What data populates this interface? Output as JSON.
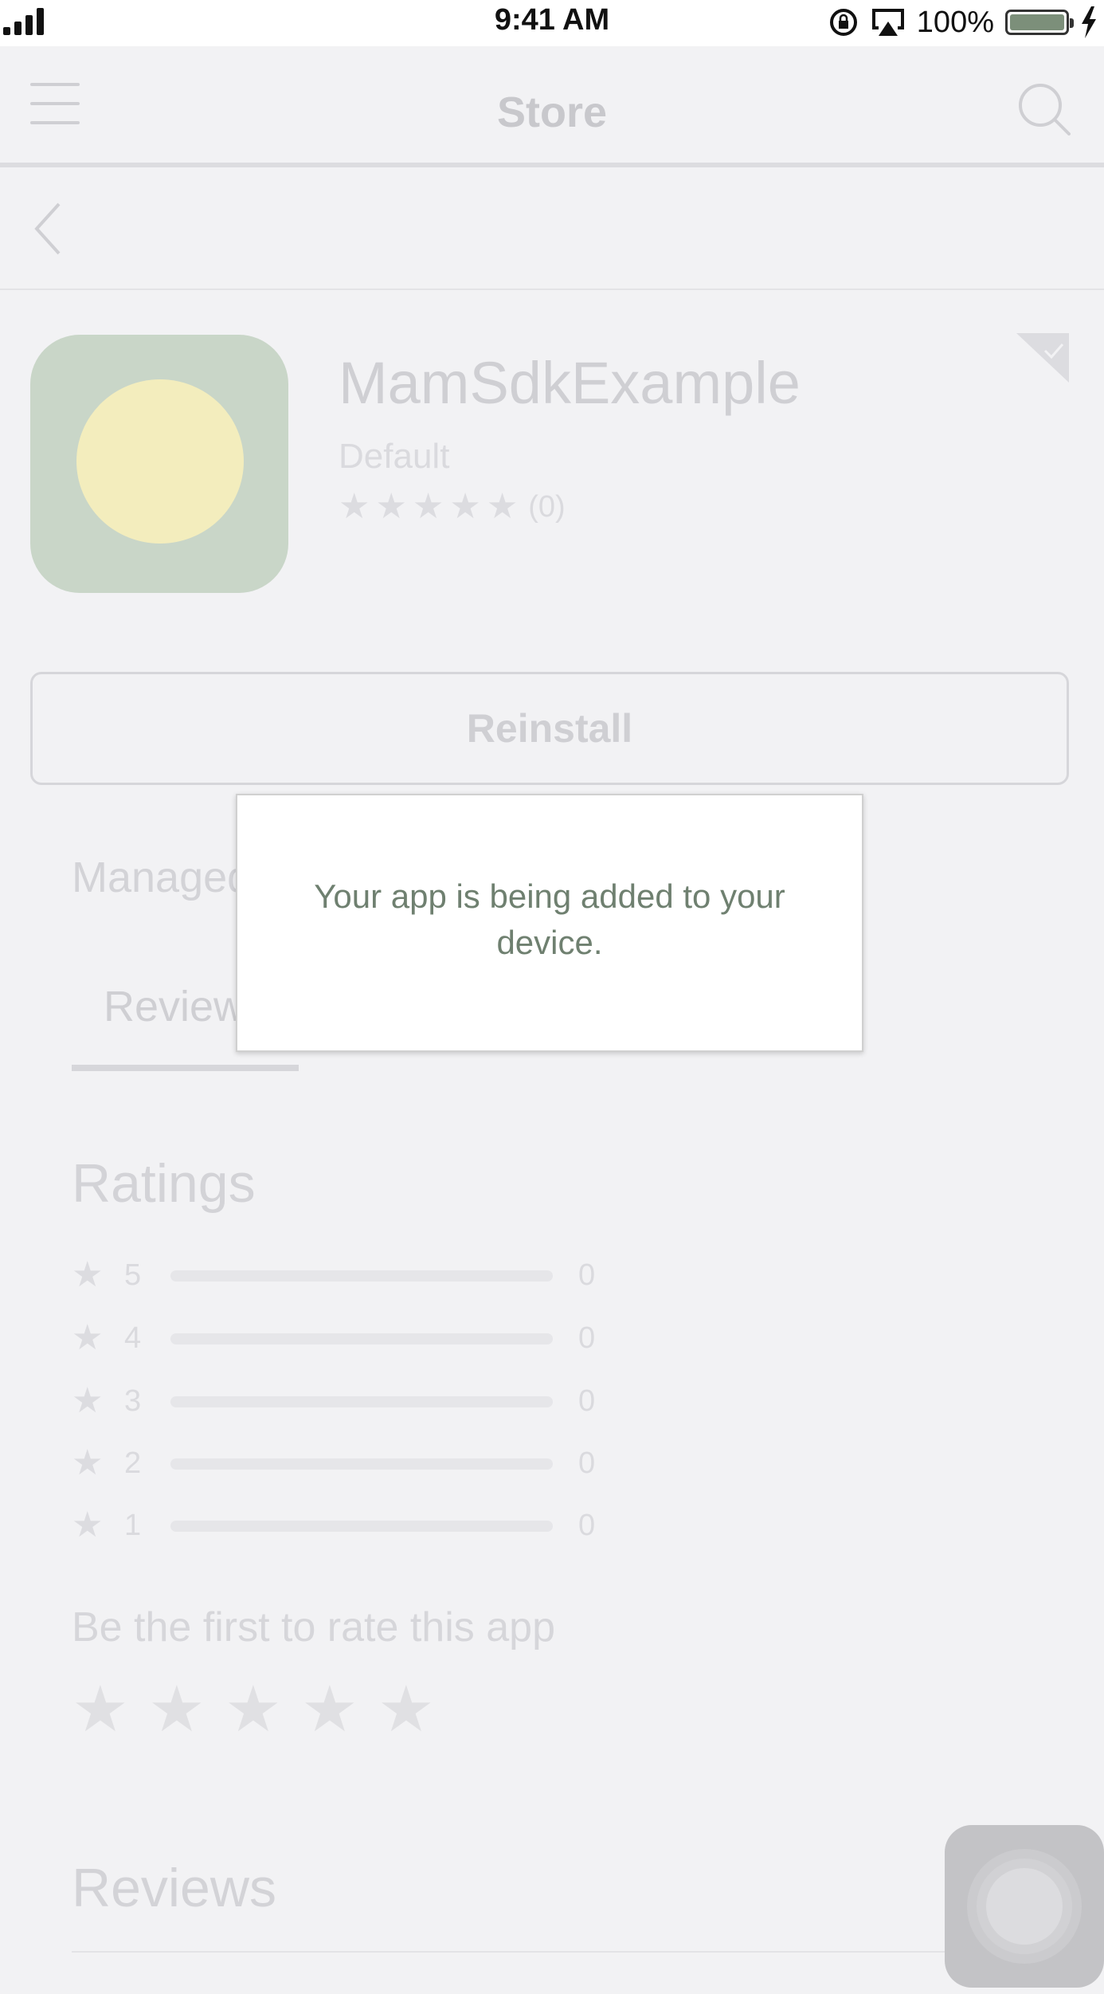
{
  "status_bar": {
    "time": "9:41 AM",
    "battery_percent": "100%",
    "battery_level": 1.0,
    "icons": [
      "cellular-signal-icon",
      "rotation-lock-icon",
      "airplay-icon",
      "battery-icon",
      "charging-bolt-icon"
    ]
  },
  "nav": {
    "title": "Store",
    "menu_icon": "hamburger-menu-icon",
    "search_icon": "search-icon",
    "back_icon": "chevron-left-icon"
  },
  "app": {
    "name": "MamSdkExample",
    "category": "Default",
    "rating_stars": 5,
    "rating_count": "(0)",
    "badge_icon": "installed-check-corner-icon"
  },
  "actions": {
    "reinstall_label": "Reinstall"
  },
  "partial_text": {
    "managed": "Managed",
    "reviews_tab": "Reviews"
  },
  "ratings": {
    "title": "Ratings",
    "rows": [
      {
        "stars": "5",
        "count": "0",
        "fraction": 0
      },
      {
        "stars": "4",
        "count": "0",
        "fraction": 0
      },
      {
        "stars": "3",
        "count": "0",
        "fraction": 0
      },
      {
        "stars": "2",
        "count": "0",
        "fraction": 0
      },
      {
        "stars": "1",
        "count": "0",
        "fraction": 0
      }
    ],
    "first_rate_prompt": "Be the first to rate this app",
    "input_stars": 5
  },
  "reviews": {
    "title": "Reviews"
  },
  "modal": {
    "message": "Your app is being added to your device."
  },
  "colors": {
    "modal_text": "#6f8070",
    "app_icon_bg": "#c9d6c8",
    "app_icon_sun": "#f3edbd",
    "battery_fill": "#7c8f7a"
  }
}
